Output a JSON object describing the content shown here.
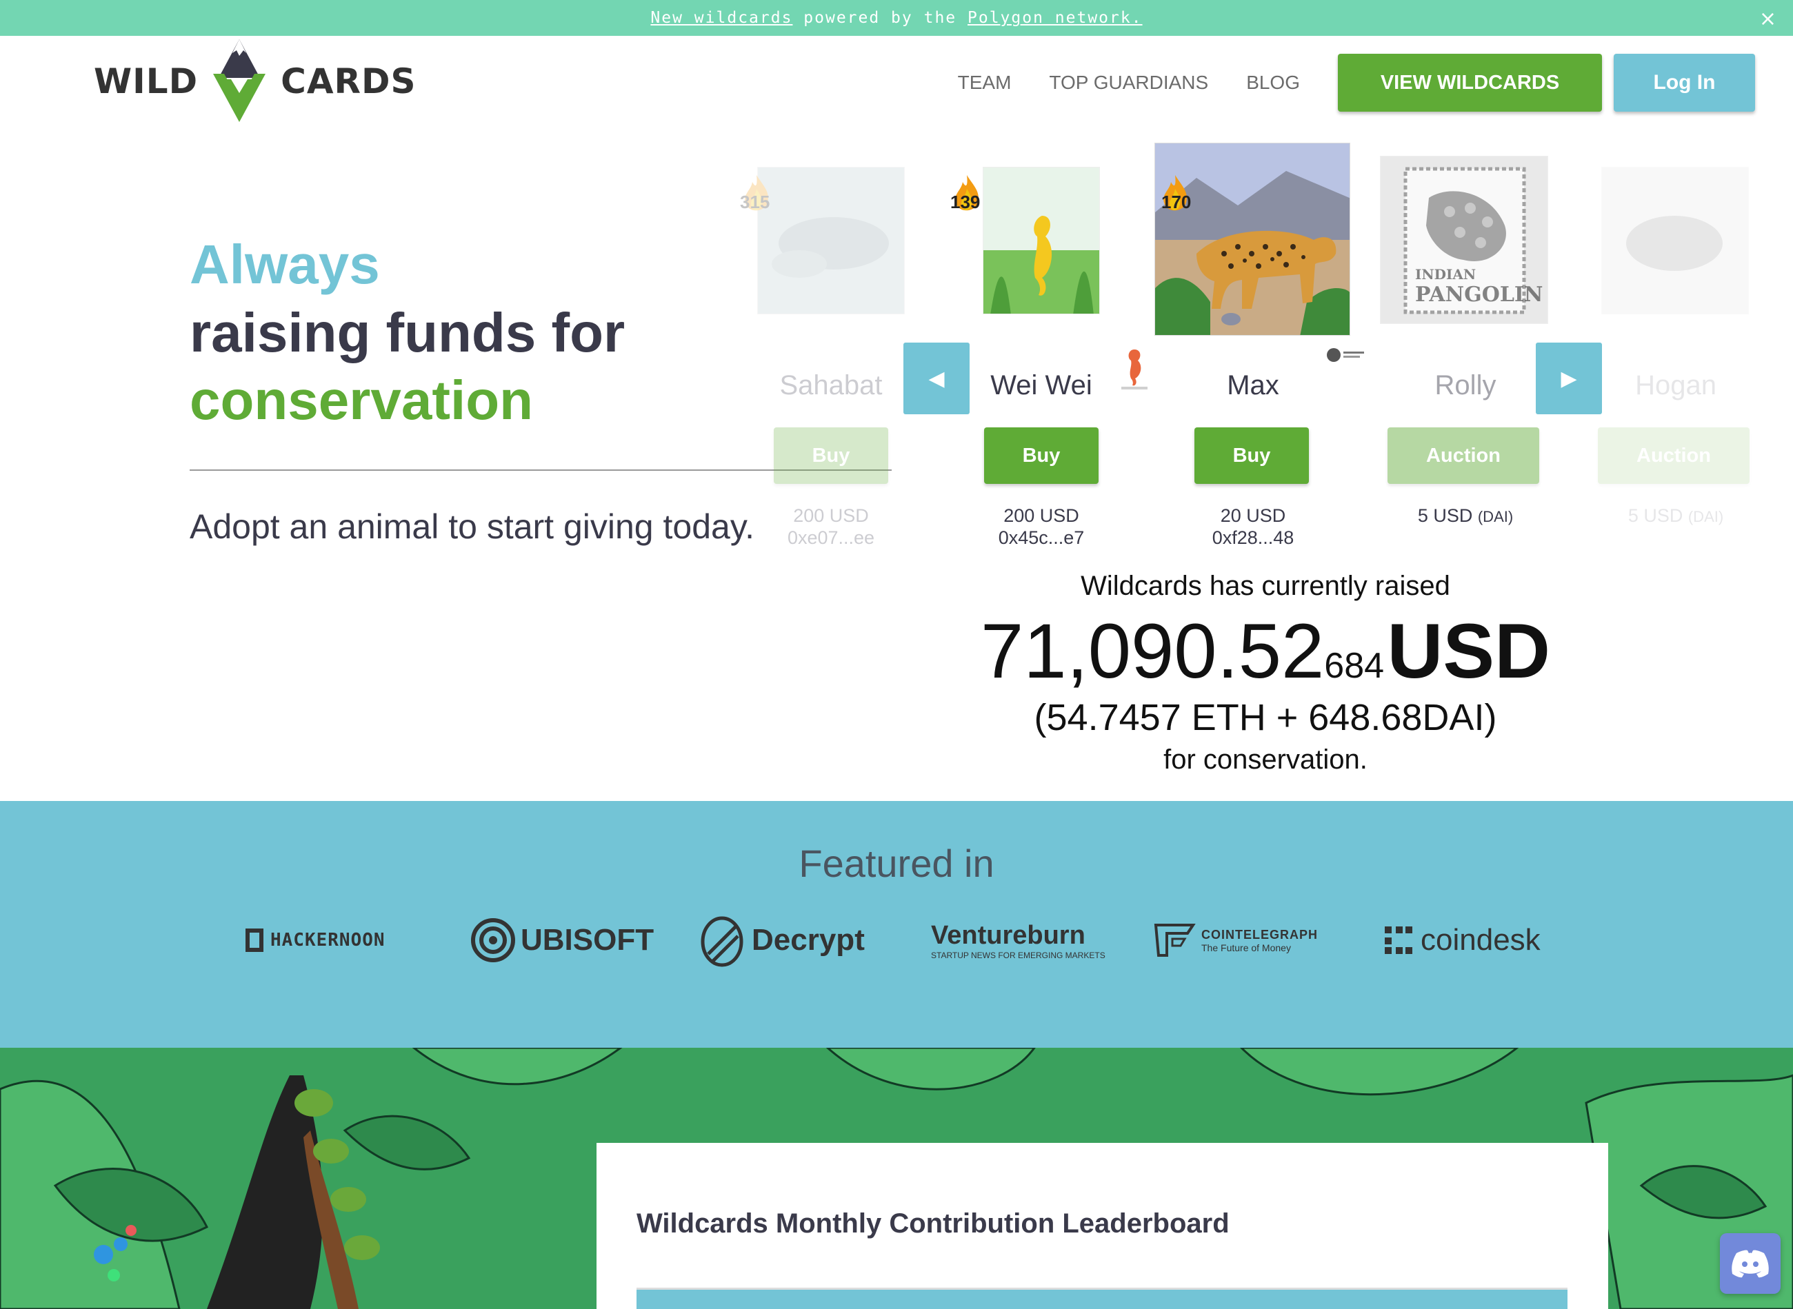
{
  "announcement": {
    "link1": "New wildcards",
    "middle": " powered by the ",
    "link2": "Polygon network.",
    "close": "×"
  },
  "logo": {
    "left": "WILD",
    "right": "CARDS"
  },
  "nav": {
    "team": "TEAM",
    "top_guardians": "TOP GUARDIANS",
    "blog": "BLOG",
    "view_wildcards": "VIEW WILDCARDS",
    "login": "Log In"
  },
  "hero": {
    "always": "Always",
    "raising": "raising funds for",
    "conservation": "conservation",
    "subtitle": "Adopt an animal to start giving today."
  },
  "cards": [
    {
      "name": "Sahabat",
      "count": "315",
      "button": "Buy",
      "price": "200 USD",
      "address": "0xe07...ee"
    },
    {
      "name": "Wei Wei",
      "count": "139",
      "button": "Buy",
      "price": "200 USD",
      "address": "0x45c...e7"
    },
    {
      "name": "Max",
      "count": "170",
      "button": "Buy",
      "price": "20 USD",
      "address": "0xf28...48"
    },
    {
      "name": "Rolly",
      "button": "Auction",
      "price": "5 USD",
      "currency": "(DAI)",
      "stamp_line1": "INDIAN",
      "stamp_line2": "PANGOLIN"
    },
    {
      "name": "Hogan",
      "button": "Auction",
      "price": "5 USD",
      "currency": "(DAI)"
    }
  ],
  "carousel": {
    "prev": "◀",
    "next": "▶"
  },
  "raised": {
    "label": "Wildcards has currently raised",
    "amount_main": "71,090.52",
    "amount_small": "684",
    "currency": "USD",
    "breakdown": "(54.7457 ETH + 648.68DAI)",
    "for": "for conservation."
  },
  "featured": {
    "title": "Featured in",
    "outlets": [
      "HACKERNOON",
      "UBISOFT",
      "Decrypt",
      "Ventureburn",
      "COINTELEGRAPH",
      "coindesk"
    ],
    "ventureburn_tagline": "STARTUP NEWS FOR EMERGING MARKETS",
    "cointelegraph_tagline": "The Future of Money"
  },
  "leaderboard": {
    "title": "Wildcards Monthly Contribution Leaderboard"
  },
  "colors": {
    "green": "#5fab36",
    "blue": "#73c4d6",
    "mint": "#73d6b2",
    "dark": "#3a3a4a",
    "jungle": "#3aa15d"
  }
}
